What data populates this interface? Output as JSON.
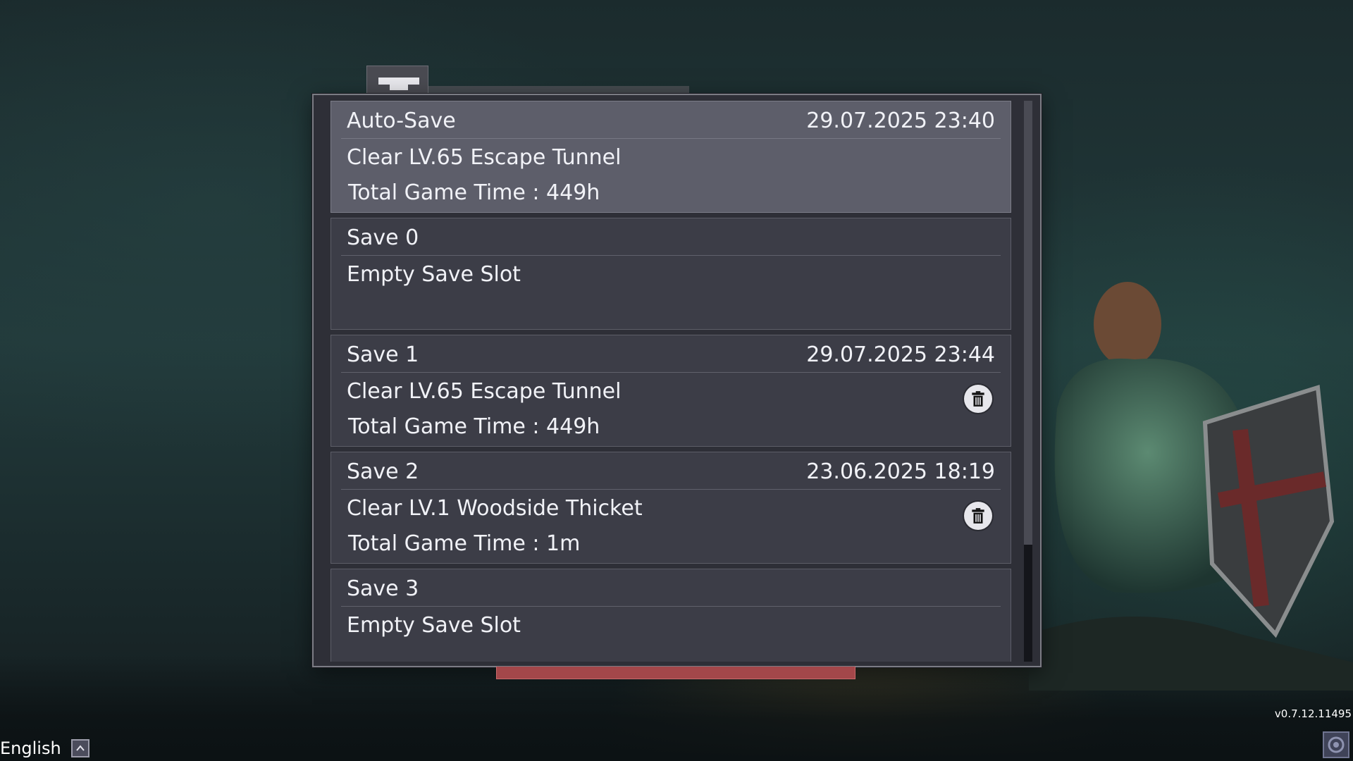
{
  "tab": {
    "icon": "bars-icon"
  },
  "slots": [
    {
      "name": "Auto-Save",
      "date": "29.07.2025 23:40",
      "stage": "Clear LV.65 Escape Tunnel",
      "time": "Total Game Time : 449h",
      "selected": true,
      "deletable": false
    },
    {
      "name": "Save 0",
      "date": "",
      "stage": "Empty Save Slot",
      "time": "",
      "selected": false,
      "deletable": false
    },
    {
      "name": "Save 1",
      "date": "29.07.2025 23:44",
      "stage": "Clear LV.65 Escape Tunnel",
      "time": "Total Game Time : 449h",
      "selected": false,
      "deletable": true
    },
    {
      "name": "Save 2",
      "date": "23.06.2025 18:19",
      "stage": "Clear LV.1 Woodside Thicket",
      "time": "Total Game Time : 1m",
      "selected": false,
      "deletable": true
    },
    {
      "name": "Save 3",
      "date": "",
      "stage": "Empty Save Slot",
      "time": "",
      "selected": false,
      "deletable": false
    }
  ],
  "delete_icon": "trash-icon",
  "language": {
    "label": "English",
    "icon": "chevron-up-icon"
  },
  "version": "v0.7.12.11495",
  "corner_icon": "settings-icon",
  "colors": {
    "panel": "#2e2f37",
    "slot": "#3c3d47",
    "slot_selected": "#5d5e6a",
    "accent_red": "#a3474a"
  }
}
